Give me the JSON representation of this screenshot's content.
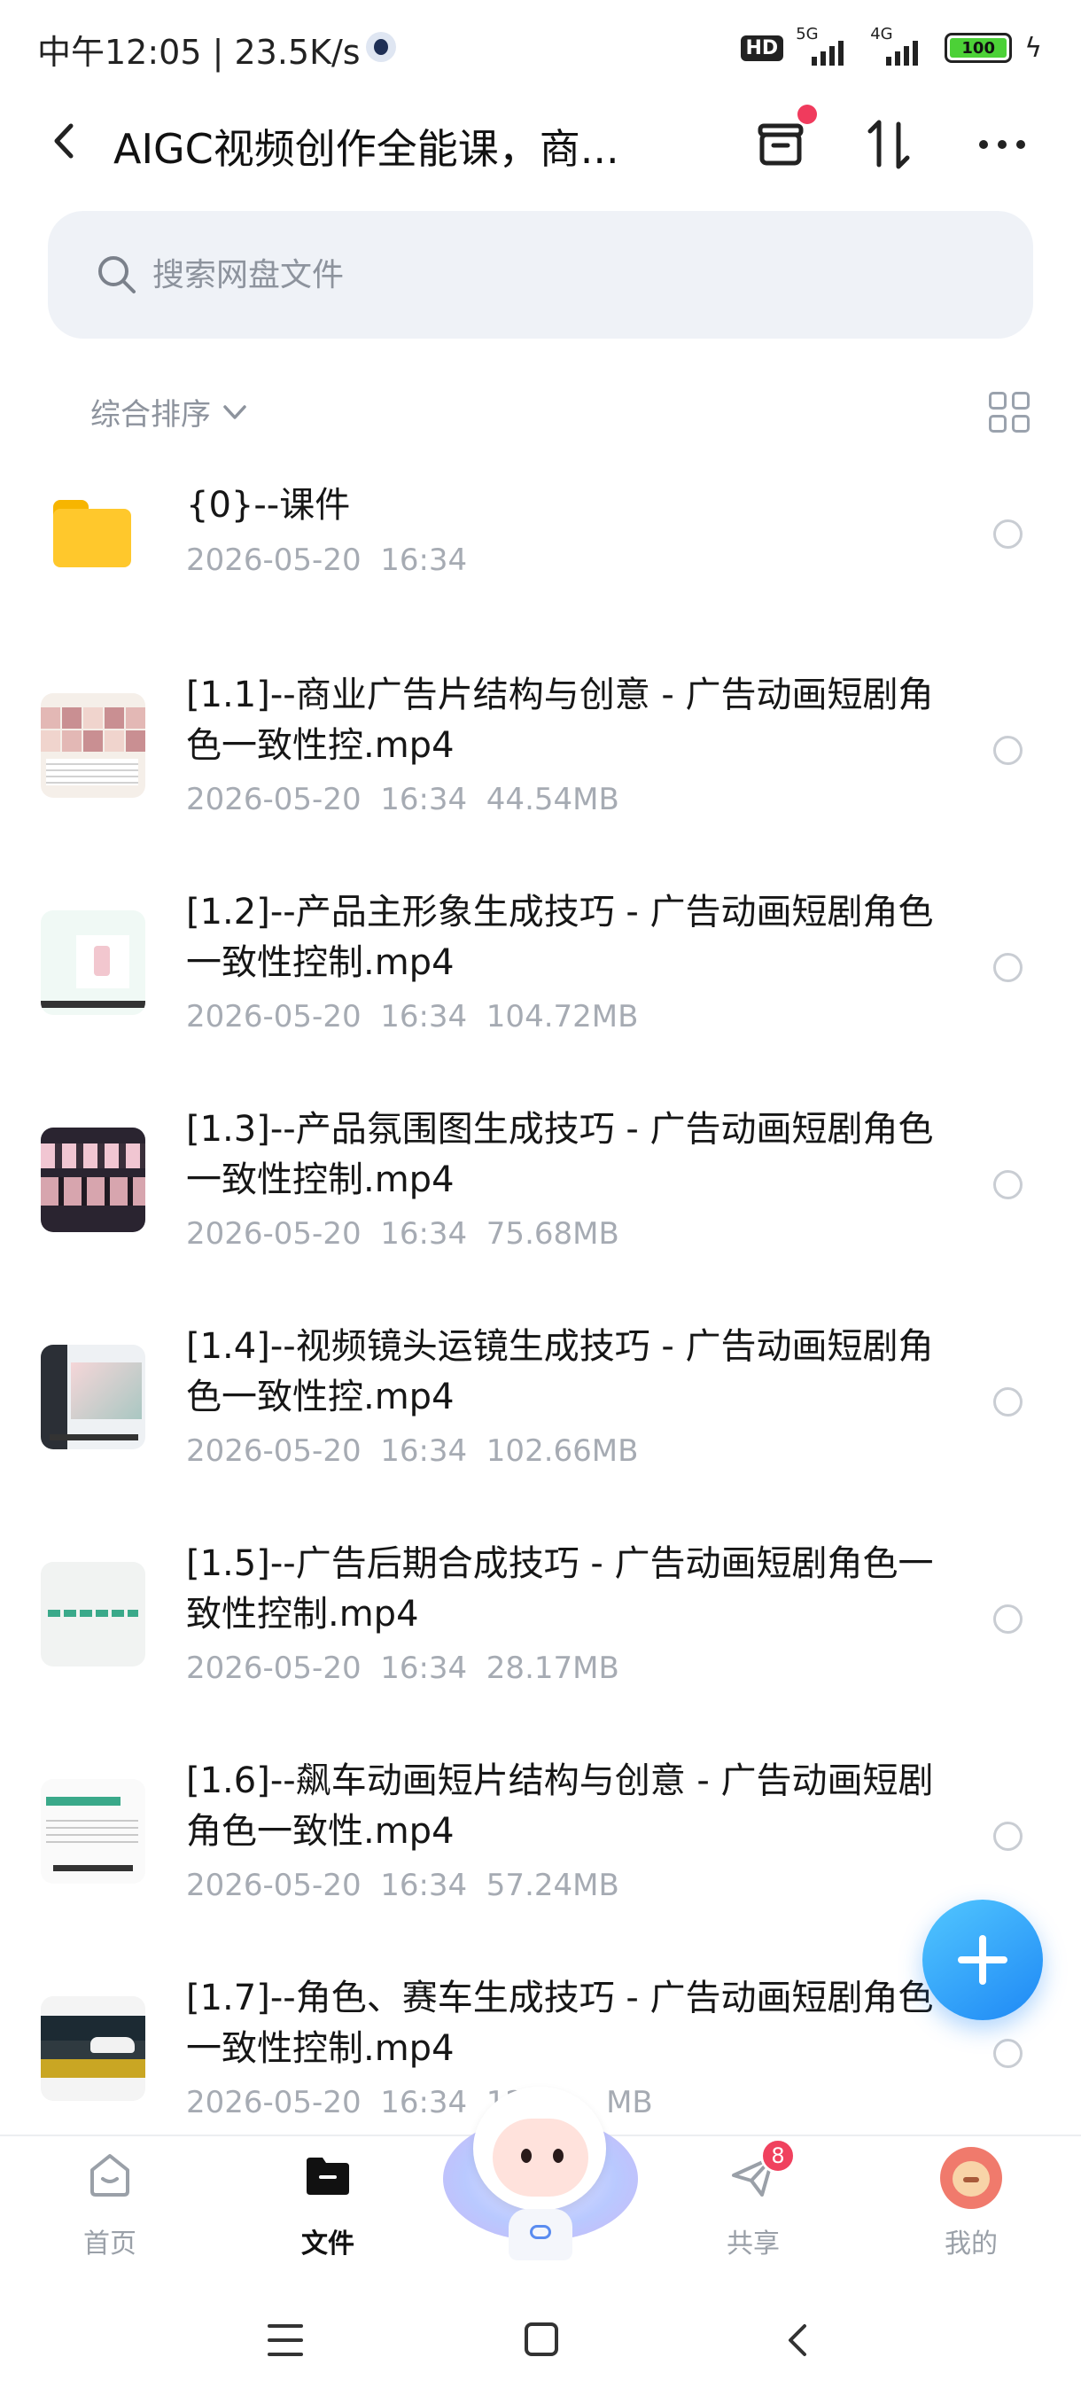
{
  "status_bar": {
    "time_speed": "中午12:05 | 23.5K/s",
    "hd": "HD",
    "signal1": "5G",
    "signal2": "4G",
    "battery": "100"
  },
  "header": {
    "title": "AIGC视频创作全能课，商..."
  },
  "search": {
    "placeholder": "搜索网盘文件"
  },
  "sort": {
    "label": "综合排序"
  },
  "files": [
    {
      "name": "{0}--课件",
      "meta": "2026-05-20  16:34",
      "type": "folder"
    },
    {
      "name": "[1.1]--商业广告片结构与创意 - 广告动画短剧角色一致性控.mp4",
      "meta": "2026-05-20  16:34  44.54MB",
      "type": "video"
    },
    {
      "name": "[1.2]--产品主形象生成技巧 - 广告动画短剧角色一致性控制.mp4",
      "meta": "2026-05-20  16:34  104.72MB",
      "type": "video"
    },
    {
      "name": "[1.3]--产品氛围图生成技巧 - 广告动画短剧角色一致性控制.mp4",
      "meta": "2026-05-20  16:34  75.68MB",
      "type": "video"
    },
    {
      "name": "[1.4]--视频镜头运镜生成技巧 - 广告动画短剧角色一致性控.mp4",
      "meta": "2026-05-20  16:34  102.66MB",
      "type": "video"
    },
    {
      "name": "[1.5]--广告后期合成技巧 - 广告动画短剧角色一致性控制.mp4",
      "meta": "2026-05-20  16:34  28.17MB",
      "type": "video"
    },
    {
      "name": "[1.6]--飙车动画短片结构与创意 - 广告动画短剧角色一致性.mp4",
      "meta": "2026-05-20  16:34  57.24MB",
      "type": "video"
    },
    {
      "name": "[1.7]--角色、赛车生成技巧 - 广告动画短剧角色一致性控制.mp4",
      "meta": "2026-05-20  16:34  12",
      "meta_tail": "MB",
      "type": "video"
    }
  ],
  "bottom_nav": {
    "home": "首页",
    "files": "文件",
    "share": "共享",
    "share_badge": "8",
    "mine": "我的"
  },
  "colors": {
    "accent": "#1e88f5",
    "badge": "#f0415e",
    "folder": "#ffc82c"
  }
}
